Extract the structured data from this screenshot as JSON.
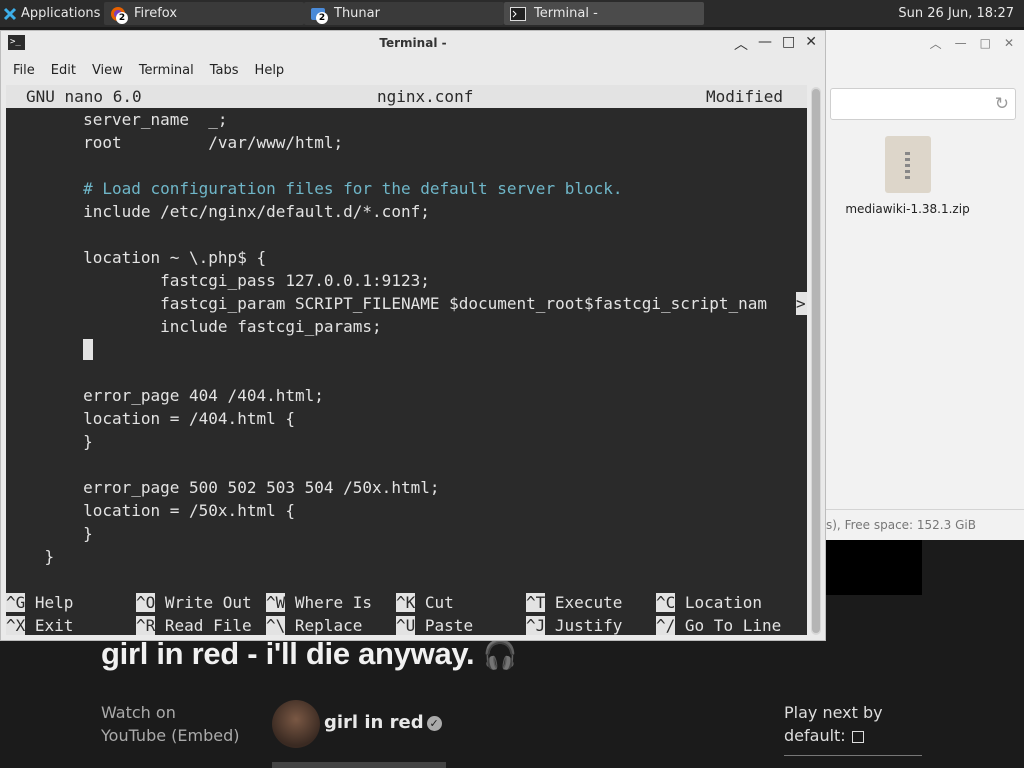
{
  "taskbar": {
    "apps_label": "Applications",
    "tasks": [
      {
        "label": "Firefox",
        "badge": "2"
      },
      {
        "label": "Thunar",
        "badge": "2"
      },
      {
        "label": "Terminal -"
      }
    ],
    "clock": "Sun 26 Jun, 18:27"
  },
  "thunar": {
    "file_name": "mediawiki-1.38.1.zip",
    "status": "s), Free space: 152.3 GiB"
  },
  "youtube": {
    "title": "girl in red - i'll die anyway.",
    "watch_on": "Watch on",
    "youtube_embed": "YouTube (Embed)",
    "channel": "girl in red",
    "play_next_1": "Play next by",
    "play_next_2": "default:"
  },
  "terminal": {
    "title": "Terminal -",
    "menu": [
      "File",
      "Edit",
      "View",
      "Terminal",
      "Tabs",
      "Help"
    ],
    "nano": {
      "version": "GNU nano 6.0",
      "filename": "nginx.conf",
      "state": "Modified"
    },
    "lines": [
      "        server_name  _;",
      "        root         /var/www/html;",
      "",
      "        # Load configuration files for the default server block.",
      "        include /etc/nginx/default.d/*.conf;",
      "",
      "        location ~ \\.php$ {",
      "                fastcgi_pass 127.0.0.1:9123;",
      "                fastcgi_param SCRIPT_FILENAME $document_root$fastcgi_script_nam",
      "                include fastcgi_params;",
      "        ",
      "",
      "        error_page 404 /404.html;",
      "        location = /404.html {",
      "        }",
      "",
      "        error_page 500 502 503 504 /50x.html;",
      "        location = /50x.html {",
      "        }",
      "    }"
    ],
    "truncation_marker": ">",
    "shortcuts": [
      {
        "key": "^G",
        "label": "Help"
      },
      {
        "key": "^O",
        "label": "Write Out"
      },
      {
        "key": "^W",
        "label": "Where Is"
      },
      {
        "key": "^K",
        "label": "Cut"
      },
      {
        "key": "^T",
        "label": "Execute"
      },
      {
        "key": "^C",
        "label": "Location"
      },
      {
        "key": "^X",
        "label": "Exit"
      },
      {
        "key": "^R",
        "label": "Read File"
      },
      {
        "key": "^\\",
        "label": "Replace"
      },
      {
        "key": "^U",
        "label": "Paste"
      },
      {
        "key": "^J",
        "label": "Justify"
      },
      {
        "key": "^/",
        "label": "Go To Line"
      }
    ]
  }
}
